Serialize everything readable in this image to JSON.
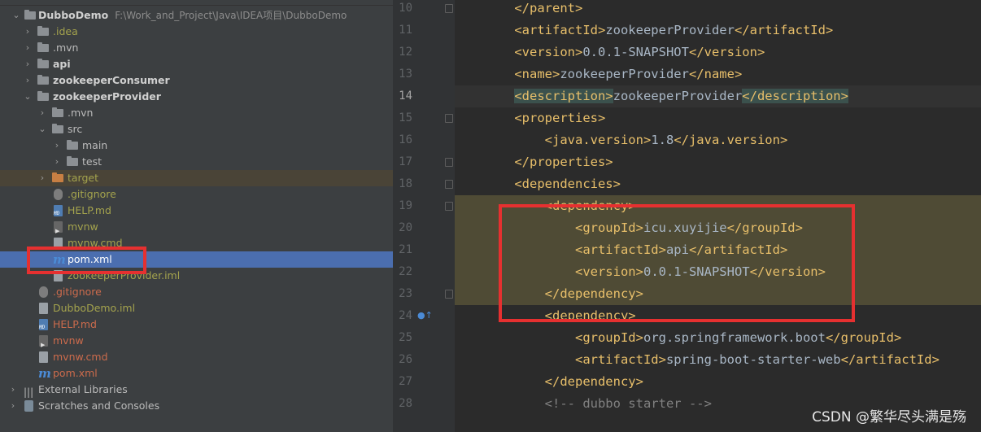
{
  "project_tree": {
    "root": {
      "name": "DubboDemo",
      "path": "F:\\Work_and_Project\\Java\\IDEA项目\\DubboDemo"
    },
    "items": [
      {
        "label": ".idea"
      },
      {
        "label": ".mvn"
      },
      {
        "label": "api"
      },
      {
        "label": "zookeeperConsumer"
      },
      {
        "label": "zookeeperProvider"
      },
      {
        "label": ".mvn"
      },
      {
        "label": "src"
      },
      {
        "label": "main"
      },
      {
        "label": "test"
      },
      {
        "label": "target"
      },
      {
        "label": ".gitignore"
      },
      {
        "label": "HELP.md"
      },
      {
        "label": "mvnw"
      },
      {
        "label": "mvnw.cmd"
      },
      {
        "label": "pom.xml"
      },
      {
        "label": "zookeeperProvider.iml"
      },
      {
        "label": ".gitignore"
      },
      {
        "label": "DubboDemo.iml"
      },
      {
        "label": "HELP.md"
      },
      {
        "label": "mvnw"
      },
      {
        "label": "mvnw.cmd"
      },
      {
        "label": "pom.xml"
      },
      {
        "label": "External Libraries"
      },
      {
        "label": "Scratches and Consoles"
      }
    ]
  },
  "editor": {
    "current_line": 14,
    "lines": [
      {
        "num": "10",
        "indent": "    ",
        "parts": [
          {
            "t": "</parent>",
            "c": "tag"
          }
        ]
      },
      {
        "num": "11",
        "indent": "    ",
        "parts": [
          {
            "t": "<artifactId>",
            "c": "tag"
          },
          {
            "t": "zookeeperProvider",
            "c": "txt"
          },
          {
            "t": "</artifactId>",
            "c": "tag"
          }
        ]
      },
      {
        "num": "12",
        "indent": "    ",
        "parts": [
          {
            "t": "<version>",
            "c": "tag"
          },
          {
            "t": "0.0.1-SNAPSHOT",
            "c": "txt"
          },
          {
            "t": "</version>",
            "c": "tag"
          }
        ]
      },
      {
        "num": "13",
        "indent": "    ",
        "parts": [
          {
            "t": "<name>",
            "c": "tag"
          },
          {
            "t": "zookeeperProvider",
            "c": "txt"
          },
          {
            "t": "</name>",
            "c": "tag"
          }
        ]
      },
      {
        "num": "14",
        "indent": "    ",
        "parts": [
          {
            "t": "<description>",
            "c": "tag match"
          },
          {
            "t": "zookeeperProvider",
            "c": "txt"
          },
          {
            "t": "</description>",
            "c": "tag match"
          }
        ]
      },
      {
        "num": "15",
        "indent": "    ",
        "parts": [
          {
            "t": "<properties>",
            "c": "tag"
          }
        ]
      },
      {
        "num": "16",
        "indent": "        ",
        "parts": [
          {
            "t": "<java.version>",
            "c": "tag"
          },
          {
            "t": "1.8",
            "c": "txt"
          },
          {
            "t": "</java.version>",
            "c": "tag"
          }
        ]
      },
      {
        "num": "17",
        "indent": "    ",
        "parts": [
          {
            "t": "</properties>",
            "c": "tag"
          }
        ]
      },
      {
        "num": "18",
        "indent": "    ",
        "parts": [
          {
            "t": "<dependencies>",
            "c": "tag"
          }
        ]
      },
      {
        "num": "19",
        "indent": "        ",
        "parts": [
          {
            "t": "<dependency>",
            "c": "tag"
          }
        ]
      },
      {
        "num": "20",
        "indent": "            ",
        "parts": [
          {
            "t": "<groupId>",
            "c": "tag"
          },
          {
            "t": "icu.xuyijie",
            "c": "txt"
          },
          {
            "t": "</groupId>",
            "c": "tag"
          }
        ]
      },
      {
        "num": "21",
        "indent": "            ",
        "parts": [
          {
            "t": "<artifactId>",
            "c": "tag"
          },
          {
            "t": "api",
            "c": "txt"
          },
          {
            "t": "</artifactId>",
            "c": "tag"
          }
        ]
      },
      {
        "num": "22",
        "indent": "            ",
        "parts": [
          {
            "t": "<version>",
            "c": "tag"
          },
          {
            "t": "0.0.1-SNAPSHOT",
            "c": "txt"
          },
          {
            "t": "</version>",
            "c": "tag"
          }
        ]
      },
      {
        "num": "23",
        "indent": "        ",
        "parts": [
          {
            "t": "</dependency>",
            "c": "tag"
          }
        ]
      },
      {
        "num": "24",
        "indent": "        ",
        "parts": [
          {
            "t": "<dependency>",
            "c": "tag"
          }
        ]
      },
      {
        "num": "25",
        "indent": "            ",
        "parts": [
          {
            "t": "<groupId>",
            "c": "tag"
          },
          {
            "t": "org.springframework.boot",
            "c": "txt"
          },
          {
            "t": "</groupId>",
            "c": "tag"
          }
        ]
      },
      {
        "num": "26",
        "indent": "            ",
        "parts": [
          {
            "t": "<artifactId>",
            "c": "tag"
          },
          {
            "t": "spring-boot-starter-web",
            "c": "txt"
          },
          {
            "t": "</artifactId>",
            "c": "tag"
          }
        ]
      },
      {
        "num": "27",
        "indent": "        ",
        "parts": [
          {
            "t": "</dependency>",
            "c": "tag"
          }
        ]
      },
      {
        "num": "28",
        "indent": "        ",
        "parts": [
          {
            "t": "<!-- dubbo starter -->",
            "c": "cmt"
          }
        ]
      }
    ]
  },
  "watermark": "CSDN @繁华尽头满是殇",
  "colors": {
    "selection": "#4b6eaf",
    "highlight_box": "#e63030",
    "tag": "#e8bf6a"
  }
}
